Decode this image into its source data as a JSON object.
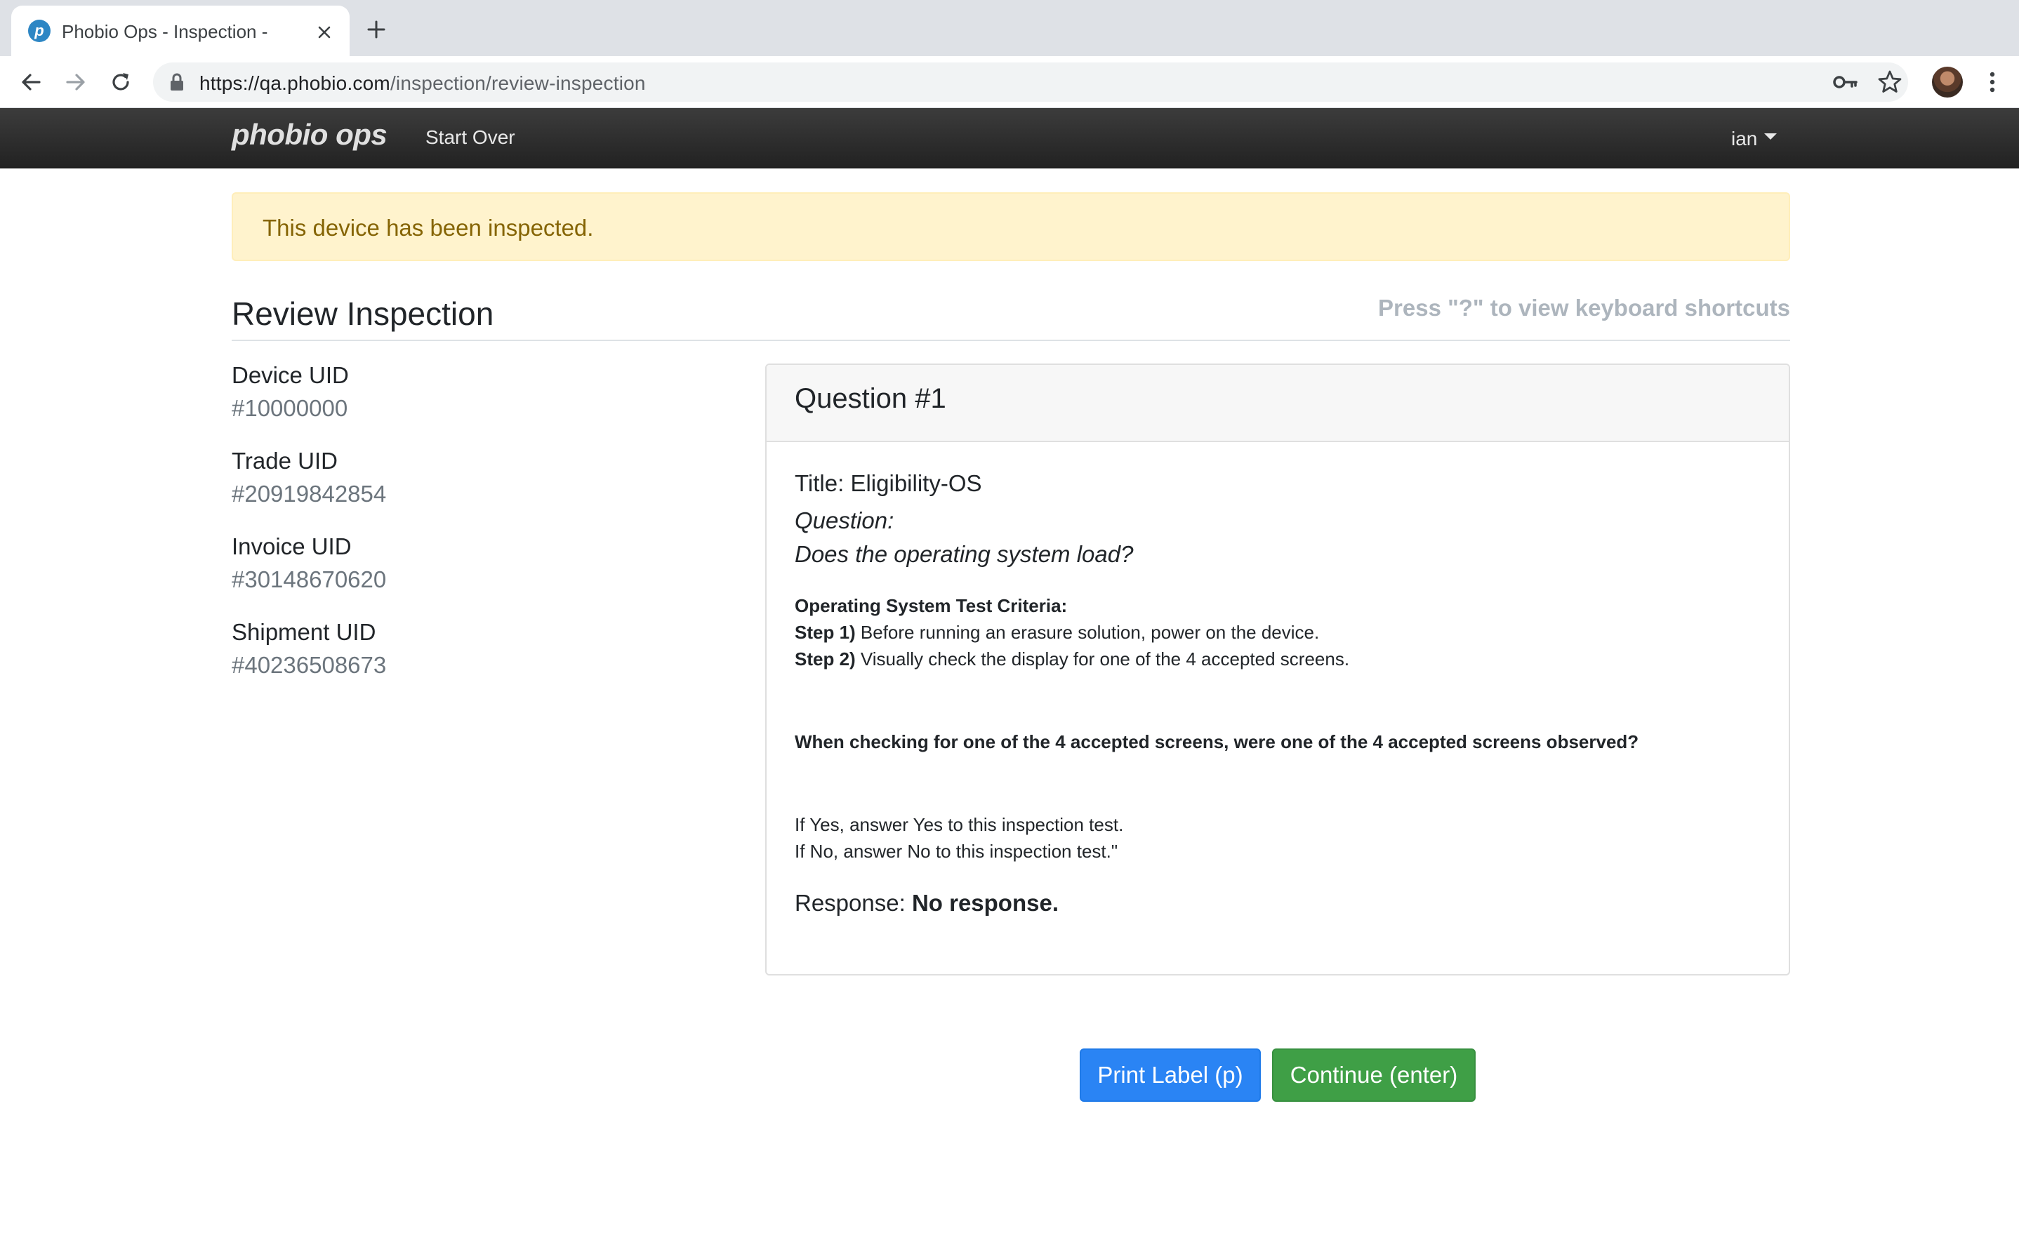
{
  "browser": {
    "tab_title": "Phobio Ops - Inspection -",
    "url_host": "https://qa.phobio.com",
    "url_path": "/inspection/review-inspection"
  },
  "navbar": {
    "brand": "phobio ops",
    "start_over": "Start Over",
    "user": "ian"
  },
  "alert": {
    "message": "This device has been inspected."
  },
  "page": {
    "title": "Review Inspection",
    "shortcut_hint": "Press \"?\" to view keyboard shortcuts"
  },
  "uids": [
    {
      "label": "Device UID",
      "value": "#10000000"
    },
    {
      "label": "Trade UID",
      "value": "#20919842854"
    },
    {
      "label": "Invoice UID",
      "value": "#30148670620"
    },
    {
      "label": "Shipment UID",
      "value": "#40236508673"
    }
  ],
  "question": {
    "header": "Question #1",
    "title": "Title: Eligibility-OS",
    "question_label": "Question:",
    "question_text": "Does the operating system load?",
    "criteria_heading": "Operating System Test Criteria:",
    "step1_label": "Step 1)",
    "step1_text": " Before running an erasure solution, power on the device.",
    "step2_label": "Step 2)",
    "step2_text": " Visually check the display for one of the 4 accepted screens.",
    "instruction": "When checking for one of the 4 accepted screens, were one of the 4 accepted screens observed?",
    "if_yes": "If Yes, answer Yes to this inspection test.",
    "if_no": "If No, answer No to this inspection test.\"",
    "response_label": "Response: ",
    "response_value": "No response."
  },
  "actions": {
    "print_label": "Print Label (p)",
    "continue": "Continue (enter)"
  },
  "colors": {
    "alert_bg": "#fff3cd",
    "alert_text": "#856404",
    "primary": "#2a84f4",
    "success": "#3f9f46",
    "navbar": "#222222"
  }
}
